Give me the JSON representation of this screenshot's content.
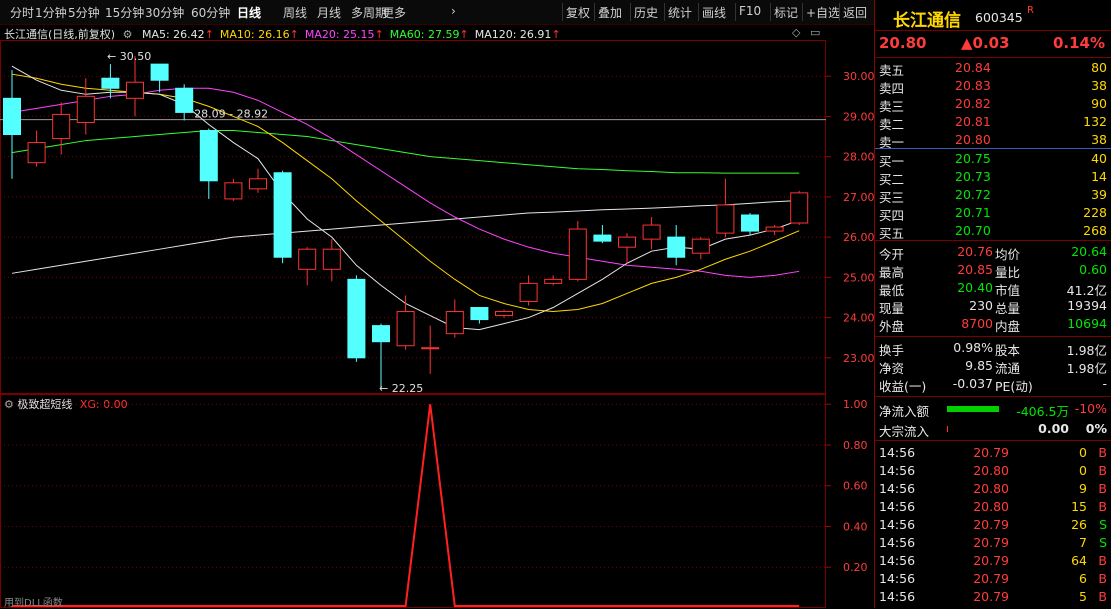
{
  "toolbar": {
    "left_items": [
      "分时",
      "1分钟",
      "5分钟",
      "15分钟",
      "30分钟",
      "60分钟",
      "日线",
      "周线",
      "月线",
      "多周期",
      "更多"
    ],
    "active": "日线",
    "right_items": [
      "复权",
      "叠加",
      "历史",
      "统计",
      "画线",
      "F10",
      "标记",
      "+自选",
      "返回"
    ]
  },
  "main_chart": {
    "title": "长江通信(日线,前复权)",
    "ma": [
      {
        "label": "MA5: 26.42",
        "color": "#e6e6e6"
      },
      {
        "label": "MA10: 26.16",
        "color": "#ffd800"
      },
      {
        "label": "MA20: 25.15",
        "color": "#ff44ff"
      },
      {
        "label": "MA60: 27.59",
        "color": "#33ff33"
      },
      {
        "label": "MA120: 26.91",
        "color": "#e6e6e6"
      }
    ],
    "high_label": "30.50",
    "low_label": "22.25",
    "range_label": "28.09 - 28.92",
    "price_ticks": [
      "30.00",
      "29.00",
      "28.00",
      "27.00",
      "26.00",
      "25.00",
      "24.00",
      "23.00"
    ],
    "ylim": [
      22.1,
      30.9
    ],
    "hline": 28.92,
    "candles": [
      {
        "o": 29.45,
        "c": 28.55,
        "h": 30.15,
        "l": 27.45
      },
      {
        "o": 27.85,
        "c": 28.35,
        "h": 28.65,
        "l": 27.75
      },
      {
        "o": 28.45,
        "c": 29.05,
        "h": 29.35,
        "l": 28.05
      },
      {
        "o": 28.85,
        "c": 29.5,
        "h": 29.95,
        "l": 28.55
      },
      {
        "o": 29.95,
        "c": 29.7,
        "h": 30.3,
        "l": 29.45
      },
      {
        "o": 29.45,
        "c": 29.85,
        "h": 30.5,
        "l": 29.0
      },
      {
        "o": 30.3,
        "c": 29.9,
        "h": 30.3,
        "l": 29.6
      },
      {
        "o": 29.7,
        "c": 29.1,
        "h": 29.8,
        "l": 28.9
      },
      {
        "o": 28.65,
        "c": 27.4,
        "h": 28.7,
        "l": 26.95
      },
      {
        "o": 26.95,
        "c": 27.35,
        "h": 27.45,
        "l": 26.9
      },
      {
        "o": 27.2,
        "c": 27.45,
        "h": 27.7,
        "l": 27.1
      },
      {
        "o": 27.6,
        "c": 25.5,
        "h": 27.65,
        "l": 25.35
      },
      {
        "o": 25.2,
        "c": 25.7,
        "h": 25.75,
        "l": 24.8
      },
      {
        "o": 25.2,
        "c": 25.7,
        "h": 25.95,
        "l": 24.9
      },
      {
        "o": 24.95,
        "c": 23.0,
        "h": 25.05,
        "l": 22.9
      },
      {
        "o": 23.8,
        "c": 23.4,
        "h": 23.85,
        "l": 22.25
      },
      {
        "o": 23.3,
        "c": 24.15,
        "h": 24.55,
        "l": 23.2
      },
      {
        "o": 23.25,
        "c": 23.25,
        "h": 23.8,
        "l": 22.6
      },
      {
        "o": 23.6,
        "c": 24.15,
        "h": 24.45,
        "l": 23.5
      },
      {
        "o": 24.25,
        "c": 23.95,
        "h": 24.25,
        "l": 23.85
      },
      {
        "o": 24.05,
        "c": 24.15,
        "h": 24.2,
        "l": 24.0
      },
      {
        "o": 24.4,
        "c": 24.85,
        "h": 25.05,
        "l": 24.3
      },
      {
        "o": 24.85,
        "c": 24.95,
        "h": 25.05,
        "l": 24.8
      },
      {
        "o": 24.95,
        "c": 26.2,
        "h": 26.4,
        "l": 24.9
      },
      {
        "o": 26.05,
        "c": 25.9,
        "h": 26.3,
        "l": 25.85
      },
      {
        "o": 25.75,
        "c": 26.0,
        "h": 26.1,
        "l": 25.35
      },
      {
        "o": 25.95,
        "c": 26.3,
        "h": 26.5,
        "l": 25.7
      },
      {
        "o": 26.0,
        "c": 25.5,
        "h": 26.3,
        "l": 25.3
      },
      {
        "o": 25.6,
        "c": 25.95,
        "h": 26.0,
        "l": 25.45
      },
      {
        "o": 26.1,
        "c": 26.8,
        "h": 27.45,
        "l": 26.0
      },
      {
        "o": 26.55,
        "c": 26.15,
        "h": 26.6,
        "l": 26.05
      },
      {
        "o": 26.15,
        "c": 26.25,
        "h": 26.3,
        "l": 26.05
      },
      {
        "o": 26.35,
        "c": 27.1,
        "h": 27.15,
        "l": 26.3
      }
    ],
    "ma5_line": [
      30.25,
      29.9,
      29.65,
      29.55,
      29.6,
      29.6,
      29.55,
      29.3,
      28.8,
      28.35,
      27.95,
      27.1,
      26.45,
      26.0,
      25.3,
      24.8,
      24.35,
      24.05,
      23.75,
      23.7,
      23.85,
      24.0,
      24.25,
      24.6,
      24.95,
      25.35,
      25.65,
      25.75,
      25.7,
      25.95,
      26.05,
      26.2,
      26.42
    ],
    "ma10_line": [
      30.05,
      29.95,
      29.8,
      29.7,
      29.65,
      29.6,
      29.55,
      29.45,
      29.25,
      29.0,
      28.75,
      28.35,
      27.9,
      27.45,
      26.9,
      26.4,
      25.9,
      25.4,
      24.95,
      24.55,
      24.35,
      24.2,
      24.15,
      24.2,
      24.35,
      24.6,
      24.85,
      25.0,
      25.2,
      25.45,
      25.65,
      25.9,
      26.16
    ],
    "ma20_line": [
      29.1,
      29.2,
      29.3,
      29.4,
      29.5,
      29.55,
      29.65,
      29.7,
      29.7,
      29.6,
      29.4,
      29.1,
      28.8,
      28.45,
      28.05,
      27.65,
      27.25,
      26.85,
      26.5,
      26.2,
      25.95,
      25.75,
      25.6,
      25.5,
      25.4,
      25.3,
      25.25,
      25.2,
      25.15,
      25.05,
      25.0,
      25.05,
      25.15
    ],
    "ma60_line": [
      28.1,
      28.2,
      28.3,
      28.4,
      28.45,
      28.5,
      28.55,
      28.6,
      28.65,
      28.65,
      28.6,
      28.55,
      28.5,
      28.4,
      28.3,
      28.2,
      28.1,
      28.0,
      27.95,
      27.9,
      27.85,
      27.8,
      27.75,
      27.7,
      27.68,
      27.65,
      27.63,
      27.6,
      27.6,
      27.59,
      27.59,
      27.59,
      27.59
    ],
    "ma120_line": [
      25.1,
      25.2,
      25.3,
      25.4,
      25.5,
      25.6,
      25.7,
      25.8,
      25.9,
      26.0,
      26.05,
      26.1,
      26.15,
      26.2,
      26.25,
      26.3,
      26.35,
      26.4,
      26.45,
      26.5,
      26.55,
      26.6,
      26.62,
      26.65,
      26.68,
      26.7,
      26.72,
      26.75,
      26.78,
      26.8,
      26.84,
      26.88,
      26.91
    ]
  },
  "sub_chart": {
    "title": "极致超短线",
    "xg_label": "XG: 0.00",
    "ticks": [
      "1.00",
      "0.80",
      "0.60",
      "0.40",
      "0.20"
    ],
    "ylim": [
      0,
      1.05
    ],
    "xg_values": [
      0,
      0,
      0,
      0,
      0,
      0,
      0,
      0,
      0,
      0,
      0,
      0,
      0,
      0,
      0,
      0,
      0,
      1,
      0,
      0,
      0,
      0,
      0,
      0,
      0,
      0,
      0,
      0,
      0,
      0,
      0,
      0,
      0
    ],
    "footer": "用到DLL函数"
  },
  "quote": {
    "name": "长江通信",
    "code": "600345",
    "badge": "R",
    "price": "20.80",
    "change": "▲0.03",
    "pct": "0.14%",
    "sell": [
      {
        "label": "卖五",
        "price": "20.84",
        "vol": "80"
      },
      {
        "label": "卖四",
        "price": "20.83",
        "vol": "38"
      },
      {
        "label": "卖三",
        "price": "20.82",
        "vol": "90"
      },
      {
        "label": "卖二",
        "price": "20.81",
        "vol": "132"
      },
      {
        "label": "卖一",
        "price": "20.80",
        "vol": "38"
      }
    ],
    "buy": [
      {
        "label": "买一",
        "price": "20.75",
        "vol": "40"
      },
      {
        "label": "买二",
        "price": "20.73",
        "vol": "14"
      },
      {
        "label": "买三",
        "price": "20.72",
        "vol": "39"
      },
      {
        "label": "买四",
        "price": "20.71",
        "vol": "228"
      },
      {
        "label": "买五",
        "price": "20.70",
        "vol": "268"
      }
    ],
    "stats": [
      {
        "l1": "今开",
        "v1": "20.76",
        "c1": "red",
        "l2": "均价",
        "v2": "20.64",
        "c2": "green"
      },
      {
        "l1": "最高",
        "v1": "20.85",
        "c1": "red",
        "l2": "量比",
        "v2": "0.60",
        "c2": "green"
      },
      {
        "l1": "最低",
        "v1": "20.40",
        "c1": "green",
        "l2": "市值",
        "v2": "41.2亿",
        "c2": "white"
      },
      {
        "l1": "现量",
        "v1": "230",
        "c1": "white",
        "l2": "总量",
        "v2": "19394",
        "c2": "white"
      },
      {
        "l1": "外盘",
        "v1": "8700",
        "c1": "red",
        "l2": "内盘",
        "v2": "10694",
        "c2": "green"
      }
    ],
    "stats2": [
      {
        "l1": "换手",
        "v1": "0.98%",
        "l2": "股本",
        "v2": "1.98亿"
      },
      {
        "l1": "净资",
        "v1": "9.85",
        "l2": "流通",
        "v2": "1.98亿"
      },
      {
        "l1": "收益(一)",
        "v1": "-0.037",
        "l2": "PE(动)",
        "v2": "-"
      }
    ],
    "flow": [
      {
        "label": "净流入额",
        "value": "-406.5万",
        "pct": "-10%",
        "bar": true
      },
      {
        "label": "大宗流入",
        "value": "0.00",
        "pct": "0%",
        "bar": false
      }
    ],
    "ticks": [
      {
        "time": "14:56",
        "price": "20.79",
        "pc": "red",
        "vol": "0",
        "side": "B"
      },
      {
        "time": "14:56",
        "price": "20.80",
        "pc": "red",
        "vol": "0",
        "side": "B"
      },
      {
        "time": "14:56",
        "price": "20.80",
        "pc": "red",
        "vol": "9",
        "side": "B"
      },
      {
        "time": "14:56",
        "price": "20.80",
        "pc": "red",
        "vol": "15",
        "side": "B"
      },
      {
        "time": "14:56",
        "price": "20.79",
        "pc": "red",
        "vol": "26",
        "side": "S"
      },
      {
        "time": "14:56",
        "price": "20.79",
        "pc": "red",
        "vol": "7",
        "side": "S"
      },
      {
        "time": "14:56",
        "price": "20.79",
        "pc": "red",
        "vol": "64",
        "side": "B"
      },
      {
        "time": "14:56",
        "price": "20.79",
        "pc": "red",
        "vol": "6",
        "side": "B"
      },
      {
        "time": "14:56",
        "price": "20.79",
        "pc": "red",
        "vol": "5",
        "side": "B"
      }
    ]
  },
  "colors": {
    "up": "#ff3232",
    "down": "#54ffff",
    "grid": "#7a0000",
    "ma5": "#e6e6e6",
    "ma10": "#ffd800",
    "ma20": "#ff44ff",
    "ma60": "#33ff33",
    "ma120": "#e6e6e6"
  }
}
